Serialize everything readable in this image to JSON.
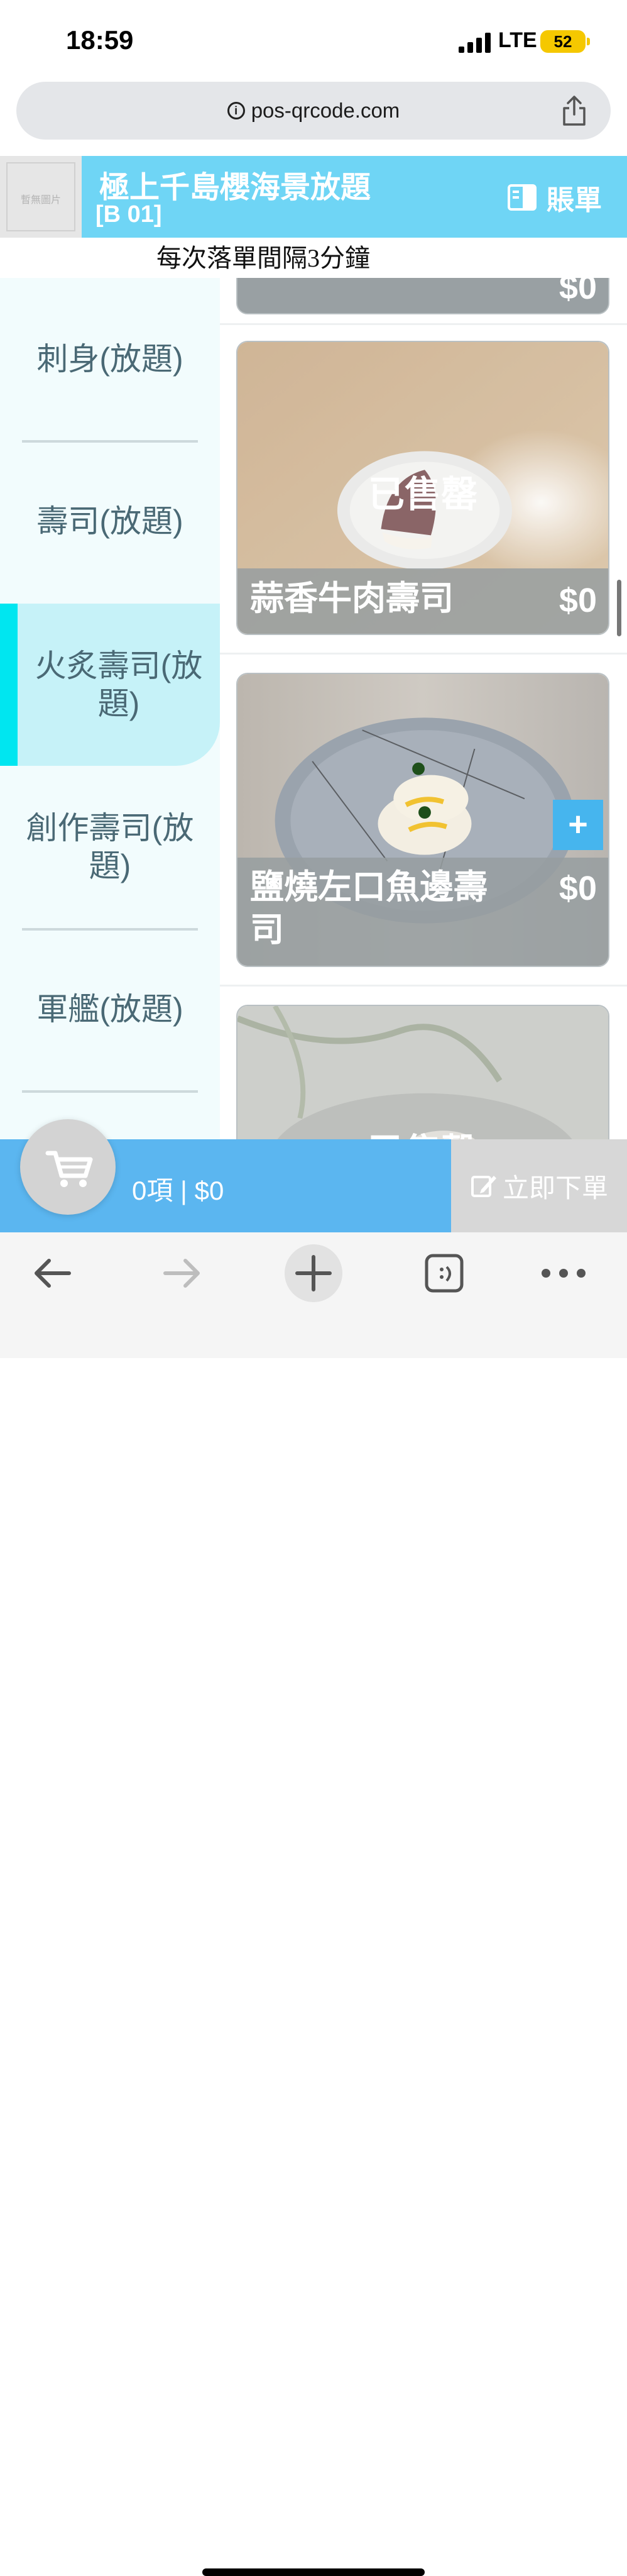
{
  "status_bar": {
    "time": "18:59",
    "network": "LTE",
    "battery": "52"
  },
  "browser": {
    "url": "pos-qrcode.com"
  },
  "header": {
    "logo_placeholder": "暫無圖片",
    "shop_name": "極上千島櫻海景放題",
    "table_no": "[B 01]",
    "bill_label": "賬單"
  },
  "notice": "每次落單間隔3分鐘",
  "categories": [
    {
      "label": "刺身(放題)",
      "active": false
    },
    {
      "label": "壽司(放題)",
      "active": false
    },
    {
      "label": "火炙壽司(放題)",
      "active": true
    },
    {
      "label": "創作壽司(放題)",
      "active": false
    },
    {
      "label": "軍艦(放題)",
      "active": false
    }
  ],
  "menu_items": [
    {
      "name": "",
      "price": "$0",
      "sold_out": false
    },
    {
      "name": "蒜香牛肉壽司",
      "price": "$0",
      "sold_out": true,
      "sold_out_label": "已售罄"
    },
    {
      "name": "鹽燒左口魚邊壽司",
      "price": "$0",
      "sold_out": false,
      "add_label": "+"
    },
    {
      "name": "",
      "price": "",
      "sold_out": true,
      "sold_out_label": "已售罄"
    }
  ],
  "cart": {
    "summary": "0項 | $0",
    "order_label": "立即下單"
  },
  "colors": {
    "header": "#6fd5f5",
    "cart": "#5bb6f0",
    "active_category": "#c6f2f8",
    "active_bar": "#00e6f0"
  },
  "icons": [
    "info-icon",
    "share-icon",
    "bill-icon",
    "cart-icon",
    "edit-icon",
    "back-icon",
    "forward-icon",
    "new-tab-icon",
    "tabs-icon",
    "more-icon"
  ]
}
